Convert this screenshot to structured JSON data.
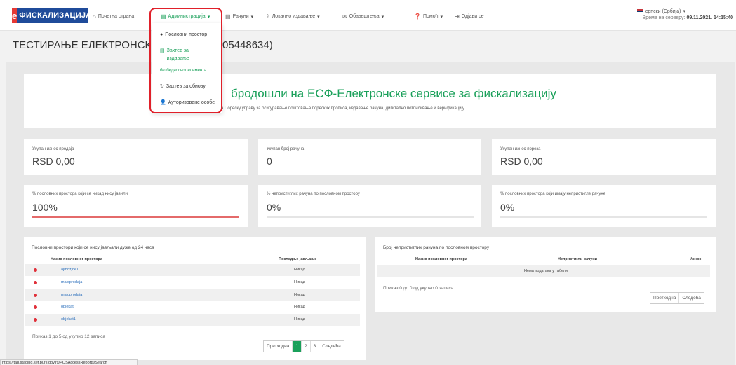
{
  "brand": {
    "logo_letter": "e",
    "logo_text": "ФИСКАЛИЗАЦИЈА"
  },
  "nav": {
    "home": "Почетна страна",
    "admin": "Администрација",
    "invoices": "Рачуни",
    "local_load": "Локално издавање",
    "notifications": "Обавештења",
    "help": "Помоћ",
    "logout": "Одјави се",
    "language": "српски (Србија)",
    "server_time_label": "Време на серверу:",
    "server_time_value": "09.11.2021. 14:15:40"
  },
  "dropdown": {
    "items": [
      "Пословни простор",
      "Захтев за издавање безбедносног елемента",
      "Захтев за обнову",
      "Ауторизоване особе"
    ],
    "item2_line1": "Захтев за",
    "item2_line2": "издавање",
    "item2_line3": "безбедносног елемента"
  },
  "page": {
    "title_left": "ТЕСТИРАЊЕ ЕЛЕКТРОНСКЕ ПР",
    "title_right": "05448634)"
  },
  "welcome": {
    "title": "бродошли на ЕСФ-Електронске сервисе за фискализацију",
    "subtitle": "окупне решење за Пореску управу за осигуравање поштовања пореских прописа, издавање рачуна, дигитално потписивање и верификацију."
  },
  "stats": [
    {
      "label": "Укупан износ продаја",
      "value": "RSD 0,00"
    },
    {
      "label": "Укупан број рачуна",
      "value": "0"
    },
    {
      "label": "Укупан износ пореза",
      "value": "RSD 0,00"
    }
  ],
  "progress": [
    {
      "label": "% пословних простора који се никад нису јавили",
      "value": "100%",
      "fraction": 1.0
    },
    {
      "label": "% непристиглих рачуна по пословном простору",
      "value": "0%",
      "fraction": 0.0
    },
    {
      "label": "% пословних простора који имају непристигле рачуне",
      "value": "0%",
      "fraction": 0.0
    }
  ],
  "left_table": {
    "title": "Пословни простори који се нису јављали дуже од 24 часа",
    "col_name": "Назив пословног простора",
    "col_last": "Последње јављање",
    "rows": [
      {
        "name": "ajmozjde1",
        "last": "Никад"
      },
      {
        "name": "maloprodaja",
        "last": "Никад"
      },
      {
        "name": "maloprodaja",
        "last": "Никад"
      },
      {
        "name": "objekat",
        "last": "Никад"
      },
      {
        "name": "objekat1",
        "last": "Никад"
      }
    ],
    "info": "Приказ 1 до 5 од укупно 12 записа",
    "pager": {
      "prev": "Претходна",
      "pages": [
        "1",
        "2",
        "3"
      ],
      "next": "Следећа"
    }
  },
  "right_table": {
    "title": "Број непристиглих рачуна по пословном простору",
    "col_name": "Назив пословног простора",
    "col_unreceived": "Непристигли рачуни",
    "col_amount": "Износ",
    "empty": "Нема података у табели",
    "info": "Приказ 0 до 0 од укупно 0 записа",
    "pager": {
      "prev": "Претходна",
      "next": "Следећа"
    }
  },
  "statusbar": {
    "url": "https://tap.staging.sef.purs.gov.rs/POSAccessReports/Search"
  },
  "colors": {
    "accent": "#1aa05a",
    "brand": "#1f4b9a",
    "danger": "#e0202a"
  }
}
